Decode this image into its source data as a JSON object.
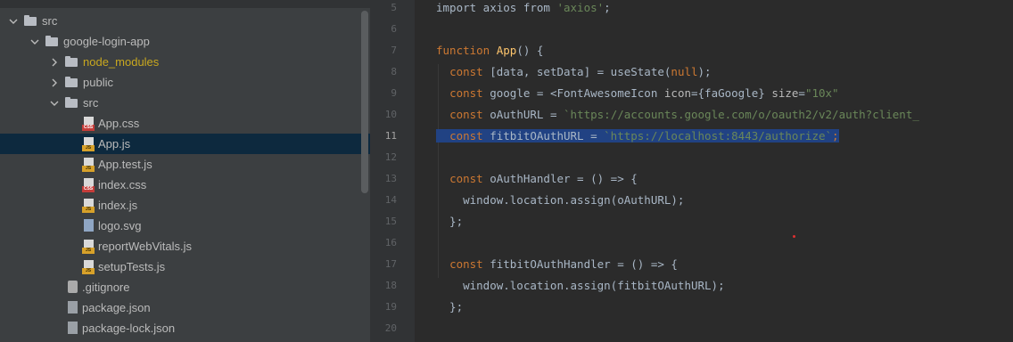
{
  "tree": {
    "items": [
      {
        "label": "src",
        "depth": 0,
        "kind": "folder",
        "arrow": "down"
      },
      {
        "label": "google-login-app",
        "depth": 1,
        "kind": "folder",
        "arrow": "down"
      },
      {
        "label": "node_modules",
        "depth": 2,
        "kind": "folder",
        "arrow": "right",
        "color": "#c9a81f"
      },
      {
        "label": "public",
        "depth": 2,
        "kind": "folder",
        "arrow": "right"
      },
      {
        "label": "src",
        "depth": 2,
        "kind": "folder",
        "arrow": "down"
      },
      {
        "label": "App.css",
        "depth": 3,
        "kind": "css"
      },
      {
        "label": "App.js",
        "depth": 3,
        "kind": "js",
        "selected": true
      },
      {
        "label": "App.test.js",
        "depth": 3,
        "kind": "js"
      },
      {
        "label": "index.css",
        "depth": 3,
        "kind": "css"
      },
      {
        "label": "index.js",
        "depth": 3,
        "kind": "js"
      },
      {
        "label": "logo.svg",
        "depth": 3,
        "kind": "svg"
      },
      {
        "label": "reportWebVitals.js",
        "depth": 3,
        "kind": "js"
      },
      {
        "label": "setupTests.js",
        "depth": 3,
        "kind": "js"
      },
      {
        "label": ".gitignore",
        "depth": 2,
        "kind": "git"
      },
      {
        "label": "package.json",
        "depth": 2,
        "kind": "json"
      },
      {
        "label": "package-lock.json",
        "depth": 2,
        "kind": "json"
      }
    ]
  },
  "editor": {
    "current_line": "11",
    "lines": [
      {
        "num": "5",
        "tokens": [
          [
            "",
            "import axios from "
          ],
          [
            "str",
            "'axios'"
          ],
          [
            "",
            ";"
          ]
        ]
      },
      {
        "num": "6",
        "tokens": []
      },
      {
        "num": "7",
        "tokens": [
          [
            "kw",
            "function "
          ],
          [
            "fn",
            "App"
          ],
          [
            "",
            "() {"
          ]
        ]
      },
      {
        "num": "8",
        "tokens": [
          [
            "",
            "  "
          ],
          [
            "kw",
            "const "
          ],
          [
            "",
            "[data, setData] = useState("
          ],
          [
            "kw",
            "null"
          ],
          [
            "",
            ");"
          ]
        ]
      },
      {
        "num": "9",
        "tokens": [
          [
            "",
            "  "
          ],
          [
            "kw",
            "const "
          ],
          [
            "",
            "google = <FontAwesomeIcon "
          ],
          [
            "attr",
            "icon"
          ],
          [
            "",
            "={faGoogle} "
          ],
          [
            "attr",
            "size"
          ],
          [
            "",
            "="
          ],
          [
            "str",
            "\"10x\""
          ],
          [
            "",
            "",
            " />;"
          ]
        ]
      },
      {
        "num": "10",
        "tokens": [
          [
            "",
            "  "
          ],
          [
            "kw",
            "const "
          ],
          [
            "",
            "oAuthURL = "
          ],
          [
            "tpl",
            "`https://accounts.google.com/o/oauth2/v2/auth?client_"
          ]
        ]
      },
      {
        "num": "11",
        "highlight": true,
        "tokens": [
          [
            "",
            "  "
          ],
          [
            "kw",
            "const "
          ],
          [
            "",
            "fitbitOAuthURL = "
          ],
          [
            "tpl",
            "`https://localhost:8443/authorize`"
          ],
          [
            "kw",
            ";"
          ]
        ]
      },
      {
        "num": "12",
        "tokens": []
      },
      {
        "num": "13",
        "tokens": [
          [
            "",
            "  "
          ],
          [
            "kw",
            "const "
          ],
          [
            "",
            "oAuthHandler = () => {"
          ]
        ]
      },
      {
        "num": "14",
        "tokens": [
          [
            "",
            "    window.location.assign(oAuthURL);"
          ]
        ]
      },
      {
        "num": "15",
        "tokens": [
          [
            "",
            "  };"
          ]
        ]
      },
      {
        "num": "16",
        "tokens": []
      },
      {
        "num": "17",
        "tokens": [
          [
            "",
            "  "
          ],
          [
            "kw",
            "const "
          ],
          [
            "",
            "fitbitOAuthHandler = () => {"
          ]
        ]
      },
      {
        "num": "18",
        "tokens": [
          [
            "",
            "    window.location.assign(fitbitOAuthURL);"
          ]
        ]
      },
      {
        "num": "19",
        "tokens": [
          [
            "",
            "  };"
          ]
        ]
      },
      {
        "num": "20",
        "tokens": []
      }
    ]
  }
}
